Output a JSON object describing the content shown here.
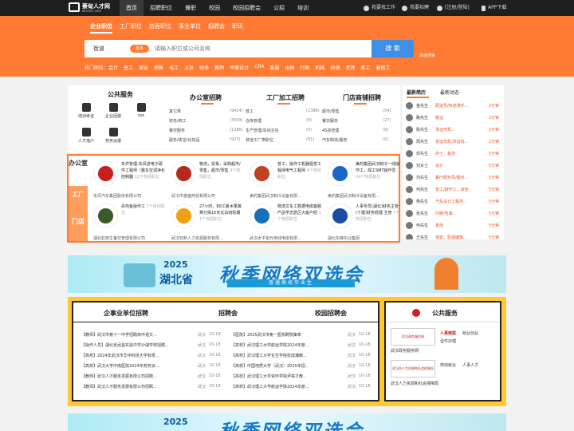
{
  "site": {
    "name": "蔡甸人才网",
    "domain": "whcdrc.com"
  },
  "nav": [
    "首页",
    "招聘职位",
    "兼职",
    "校园",
    "校园招聘会",
    "公招",
    "培训"
  ],
  "topright": {
    "find_job": "我要找工作",
    "hire": "我要招聘",
    "login": "[注册/登陆]",
    "app": "APP下载"
  },
  "tabs": [
    "企业职位",
    "工厂职位",
    "店面职位",
    "事业单位",
    "招聘会",
    "职讯"
  ],
  "search": {
    "city": "街道",
    "pill": "更多",
    "placeholder": "请输入职位或公司名称",
    "button": "搜 索",
    "advanced": "高级搜索"
  },
  "hot": [
    "热门职位：会计",
    "普工",
    "保安",
    "销售",
    "电工",
    "文员",
    "财务",
    "教师",
    "平面设计",
    "CRA",
    "客服",
    "出纳",
    "行政",
    "机械",
    "快递",
    "老师",
    "美工",
    "暑假工"
  ],
  "public_service": {
    "title": "公共服务",
    "items": [
      "培训考证",
      "企业团建",
      "rpo",
      "人才落户",
      "劳务派遣"
    ]
  },
  "columns": [
    {
      "title": "办公室招聘",
      "rows": [
        [
          "其它类",
          "(9414)"
        ],
        [
          "财务/统工",
          "(3593)"
        ],
        [
          "餐饮服务",
          "(1386)"
        ],
        [
          "服务/珠宝/化妆品",
          "(927)"
        ]
      ]
    },
    {
      "title": "工厂加工招聘",
      "rows": [
        [
          "普工",
          "(1386)"
        ],
        [
          "仓库管理",
          "(9)"
        ],
        [
          "生产管理/车间主任",
          "(0)"
        ],
        [
          "其他工厂类职位",
          "(81)"
        ]
      ]
    },
    {
      "title": "门店商铺招聘",
      "rows": [
        [
          "超市/零售",
          "(54)"
        ],
        [
          "餐饮服务",
          "(27)"
        ],
        [
          "4S店管理",
          "(9)"
        ],
        [
          "汽车制造/服务",
          "(0)"
        ]
      ]
    }
  ],
  "recent": {
    "tabs": [
      "最新简历",
      "最新动态"
    ],
    "items": [
      {
        "name": "金先生",
        "job": "配送员/快递骑手...",
        "time": "2分钟"
      },
      {
        "name": "路先生",
        "job": "搬运",
        "time": "2分钟"
      },
      {
        "name": "陈先生",
        "job": "货运司机...",
        "time": "2分钟"
      },
      {
        "name": "周先生",
        "job": "货运司机/货运线...",
        "time": "2分钟"
      },
      {
        "name": "邓先生",
        "job": "护士，其他",
        "time": "5分钟"
      },
      {
        "name": "刘女士",
        "job": "设计",
        "time": "5分钟"
      },
      {
        "name": "刘先生",
        "job": "餐厅服务员/服务...",
        "time": "5分钟"
      },
      {
        "name": "何先生",
        "job": "普工/操作工，其他",
        "time": "5分钟"
      },
      {
        "name": "杨先生",
        "job": "汽车设计工程师...",
        "time": "5分钟"
      },
      {
        "name": "张先生",
        "job": "印刷/包装...",
        "time": "5分钟"
      },
      {
        "name": "何先生",
        "job": "其他",
        "time": "5分钟"
      },
      {
        "name": "王先生",
        "job": "保安，影视编辑...",
        "time": "5分钟"
      }
    ]
  },
  "famous": {
    "side": [
      "办公室",
      "工厂",
      "门店"
    ],
    "companies": [
      {
        "info": "车件管理-东风进电子硬件工程师（整车空调净化控制器",
        "count": "12个热招职位",
        "name": "东风汽车集团股份有限公司",
        "logo_color": "#c81e1e"
      },
      {
        "info": "物流，贸易，采购超市/零售，超市/零售",
        "count": "9个热招职位",
        "name": "武汉市富盛商贸有限公司",
        "logo_color": "#b52a1c"
      },
      {
        "info": "普工，操作工机器视觉工程师电气工程师",
        "count": "9个热招职位",
        "name": "美的集团武汉制冷设备有限...",
        "logo_color": "#c04020"
      },
      {
        "info": "美的集团武汉制冷一线操作工，焊工SMT操作员",
        "count": "24个热招职位",
        "name": "美的集团武汉制冷设备有限...",
        "logo_color": "#1a65c8"
      },
      {
        "info": "杀鸡鱼操作工",
        "count": "7个热招职位",
        "name": "湖北粒鲜生餐饮管理有限公司",
        "logo_color": "#3a5a2a"
      },
      {
        "info": "27小时，80江夏水果蔬菜分拣15天长白班轮期",
        "count": "1个热招职位",
        "name": "武汉双新人力资源服务有限...",
        "logo_color": "#f0a010"
      },
      {
        "info": "物流文车工数据电缆客服产品学志愿区大客户经",
        "count": "1个热招职位",
        "name": "武汉太平窗光电线电缆有限...",
        "logo_color": "#1870b8"
      },
      {
        "info": "人事专员(湖北)财务主管(十堰)财务经理 主管",
        "count": "7个热招职位",
        "name": "湖北东峰实业集团",
        "logo_color": "#1a4da0"
      }
    ]
  },
  "banner": {
    "year": "2025",
    "province": "湖北省",
    "title": "秋季网络双选会",
    "subtitle": "普通高校毕业生"
  },
  "jobs": {
    "tabs": [
      "企事业单位招聘",
      "招聘会",
      "校园招聘会"
    ],
    "left": [
      {
        "title": "【教师】武汉市第十一中学招聘高中语文...",
        "loc": "武汉",
        "date": "10-18"
      },
      {
        "title": "【操作人员】湖北省武昌实验中学沙湖学校招聘...",
        "loc": "武汉",
        "date": "10-18"
      },
      {
        "title": "【高校】2024年武汉市华中科技大学有限...",
        "loc": "武汉",
        "date": "10-18"
      },
      {
        "title": "【高校】武汉大学中南医院2024年劳务派...",
        "loc": "武汉",
        "date": "10-18"
      },
      {
        "title": "【教师】武汉人才服务发展有限公司招聘...",
        "loc": "武汉",
        "date": "10-18"
      },
      {
        "title": "【教师】武汉人才服务发展有限公司招聘...",
        "loc": "武汉",
        "date": "10-18"
      }
    ],
    "right": [
      {
        "title": "【医院】2025武汉市第一医院聘院策章",
        "loc": "武汉",
        "date": "10-18"
      },
      {
        "title": "【高校】武汉理工大学航运学院2024年度...",
        "loc": "武汉",
        "date": "10-18"
      },
      {
        "title": "【高校】武汉理工大学化生学院张成潘教...",
        "loc": "武汉",
        "date": "10-18"
      },
      {
        "title": "【高校】中国地质大学（武汉）2025年招...",
        "loc": "武汉",
        "date": "10-18"
      },
      {
        "title": "【高校】武汉理工大学资环学院尹章才教...",
        "loc": "武汉",
        "date": "10-18"
      },
      {
        "title": "【高校】武汉理工大学航运学院2024年度...",
        "loc": "武汉",
        "date": "10-18"
      }
    ]
  },
  "pubsvc": {
    "title": "公共服务",
    "b1": {
      "logo": "武汉政务服务网",
      "l1": "人事档案",
      "l2": "就业创业",
      "l3": "证件办理",
      "caption": "武汉政务服务网"
    },
    "b2": {
      "logo": "武汉市人力资源和社会保障局",
      "l1": "劳动就业",
      "l2": "人事人才",
      "caption": "武汉人力资源和社会保障局"
    }
  }
}
